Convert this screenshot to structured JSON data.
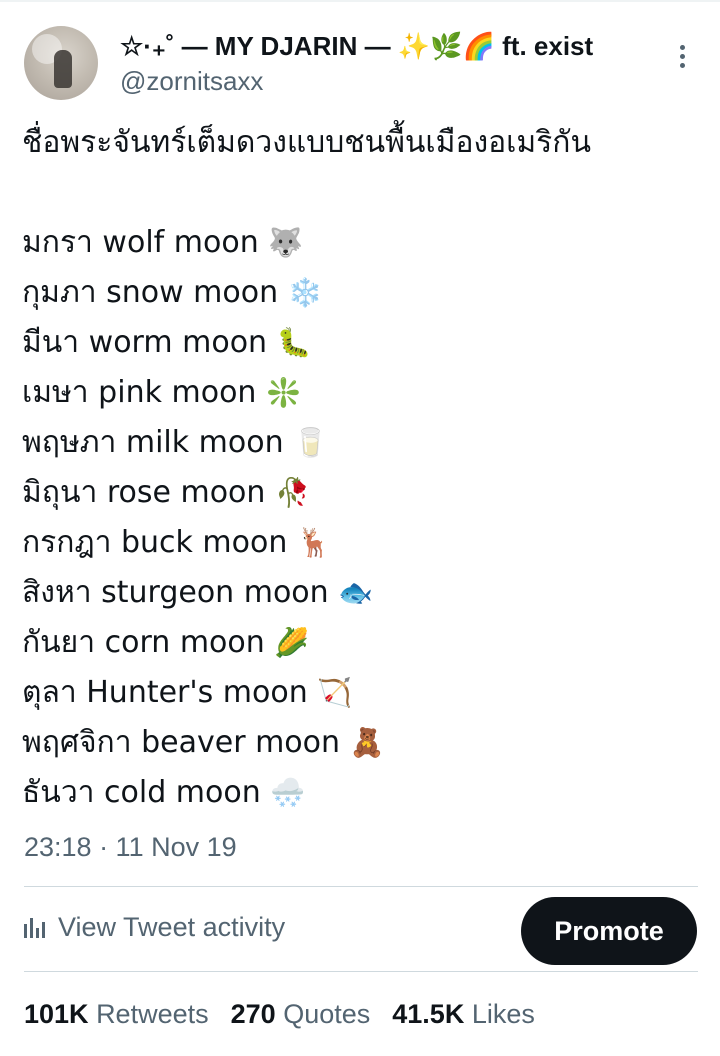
{
  "author": {
    "display_name": "☆·₊˚ — MY DJARIN — ✨🌿🌈 ft. exist",
    "username": "@zornitsaxx"
  },
  "tweet": {
    "title_line": "ชื่อพระจันทร์เต็มดวงแบบชนพื้นเมืองอเมริกัน",
    "lines": [
      {
        "text": "มกรา wolf moon",
        "emoji": "🐺"
      },
      {
        "text": "กุมภา snow moon",
        "emoji": "❄️"
      },
      {
        "text": "มีนา worm moon",
        "emoji": "🐛"
      },
      {
        "text": "เมษา pink moon",
        "emoji": "❇️"
      },
      {
        "text": "พฤษภา milk moon",
        "emoji": "🥛"
      },
      {
        "text": "มิถุนา rose moon",
        "emoji": "🥀"
      },
      {
        "text": "กรกฎา buck moon",
        "emoji": "🦌"
      },
      {
        "text": "สิงหา sturgeon moon",
        "emoji": "🐟"
      },
      {
        "text": "กันยา corn moon",
        "emoji": "🌽"
      },
      {
        "text": "ตุลา Hunter's moon",
        "emoji": "🏹"
      },
      {
        "text": "พฤศจิกา beaver moon",
        "emoji": "🧸"
      },
      {
        "text": "ธันวา cold moon",
        "emoji": "🌨️"
      }
    ],
    "timestamp": "23:18 · 11 Nov 19"
  },
  "actions": {
    "activity_label": "View Tweet activity",
    "activity_icon": "bar-chart-icon",
    "promote_label": "Promote"
  },
  "stats": {
    "retweets_count": "101K",
    "retweets_label": "Retweets",
    "quotes_count": "270",
    "quotes_label": "Quotes",
    "likes_count": "41.5K",
    "likes_label": "Likes"
  },
  "colors": {
    "text_primary": "#0f1419",
    "text_secondary": "#536471",
    "divider": "#cfd9de",
    "button_bg": "#0f1419"
  }
}
